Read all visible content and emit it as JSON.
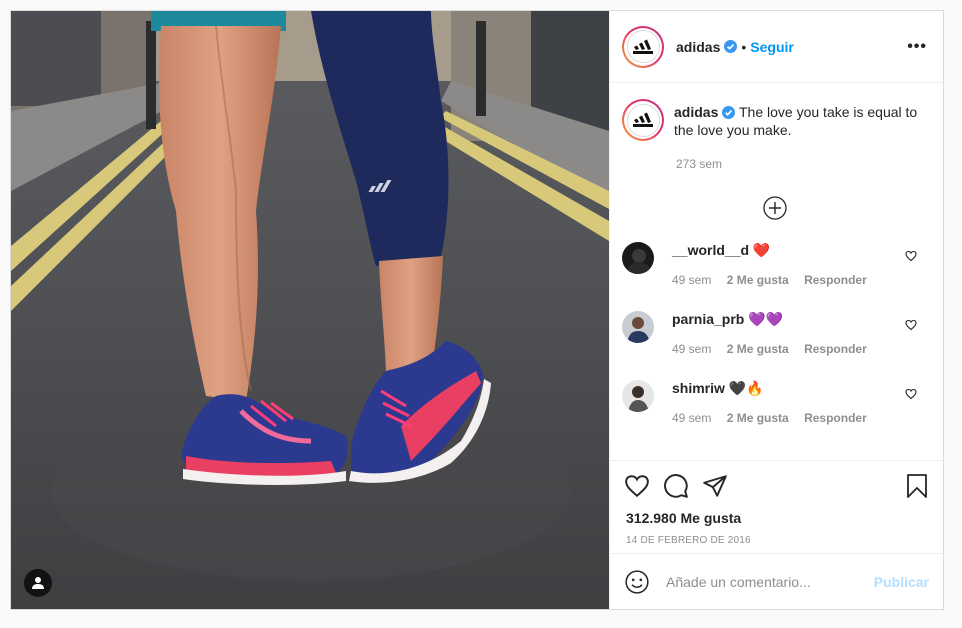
{
  "post": {
    "image_alt": "Two people standing on a road wearing pink and blue running shoes",
    "brand_logo": "adidas-logo",
    "user_tag_icon": "person-icon"
  },
  "header": {
    "username": "adidas",
    "verified_icon": "verified-badge-icon",
    "separator": "•",
    "follow_label": "Seguir",
    "more_icon": "•••"
  },
  "caption": {
    "username": "adidas",
    "text": "The love you take is equal to the love you make.",
    "time": "273 sem"
  },
  "load_more_icon": "plus-circle-icon",
  "comments": [
    {
      "username": "__world__d",
      "emoji": "❤️",
      "time": "49 sem",
      "likes_label": "2 Me gusta",
      "reply_label": "Responder"
    },
    {
      "username": "parnia_prb",
      "emoji": "💜💜",
      "time": "49 sem",
      "likes_label": "2 Me gusta",
      "reply_label": "Responder"
    },
    {
      "username": "shimriw",
      "emoji": "🖤🔥",
      "time": "49 sem",
      "likes_label": "2 Me gusta",
      "reply_label": "Responder"
    }
  ],
  "actions": {
    "likes": "312.980 Me gusta",
    "date": "14 DE FEBRERO DE 2016"
  },
  "add_comment": {
    "placeholder": "Añade un comentario...",
    "publish_label": "Publicar"
  },
  "colors": {
    "accent": "#0095f6",
    "publish_disabled": "#b2dffc",
    "text": "#262626",
    "secondary": "#8e8e8e",
    "heart_red": "#ed4956"
  }
}
